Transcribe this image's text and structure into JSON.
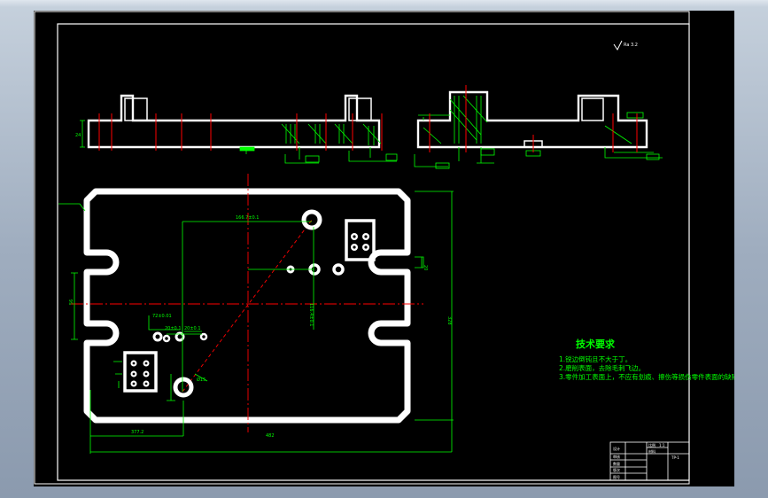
{
  "colors": {
    "background": "#000000",
    "frame": "#ffffff",
    "part": "#ffffff",
    "dimension": "#00ff00",
    "centerline": "#ff0000",
    "notes": "#00ff00",
    "chrome": "#a7b4c4"
  },
  "drawing": {
    "tech_requirements": {
      "title": "技术要求",
      "items": [
        "1.锐边倒钝且不大于丁。",
        "2.磨削表面，去除毛刺飞边。",
        "3.零件加工表面上，不应有划痕、擦伤等损伤零件表面的缺陷。"
      ]
    },
    "dimensions": {
      "overall_width": "482",
      "bottom_partial": "377.2",
      "top_offset": "166.7±0.1",
      "right_height": "328",
      "left_height": "56",
      "right_slot": "20",
      "center_vertical": "116.4±0.1",
      "hole_spacing": "72±0.01",
      "small_pitch": "20±0.1",
      "hole_pitch": "20±0.1",
      "hole_diameter": "Ø15",
      "view_thickness": "24"
    },
    "roughness_mark": "Ra 3.2",
    "title_block": {
      "cells": [
        "设计",
        "审核",
        "比例",
        "1:1",
        "材料",
        "数量",
        "版次",
        "图号"
      ],
      "code": "TP-1"
    }
  }
}
